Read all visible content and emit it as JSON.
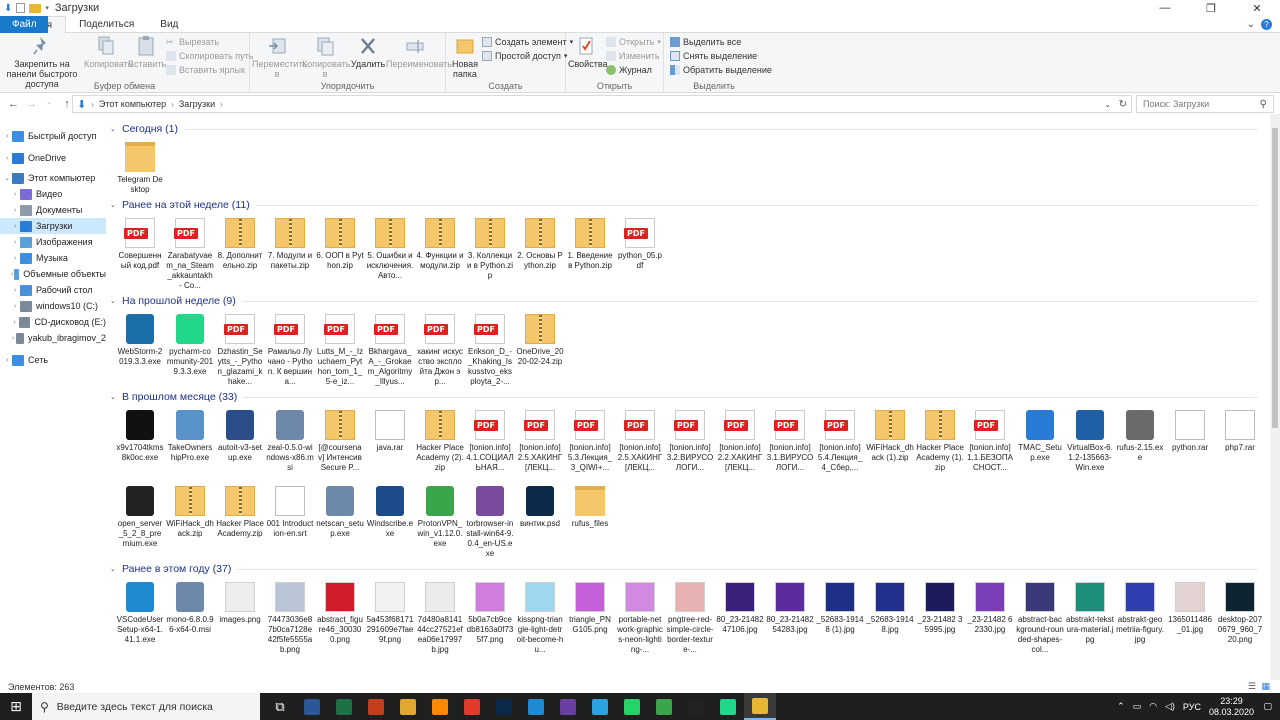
{
  "window": {
    "title": "Загрузки",
    "controls": [
      "—",
      "❐",
      "✕"
    ]
  },
  "tabs": [
    "Файл",
    "Главная",
    "Поделиться",
    "Вид"
  ],
  "ribbon": {
    "clipboard": {
      "pin": "Закрепить на панели быстрого доступа",
      "copy": "Копировать",
      "paste": "Вставить",
      "cut": "Вырезать",
      "copy_path": "Скопировать путь",
      "paste_shortcut": "Вставить ярлык",
      "label": "Буфер обмена"
    },
    "organize": {
      "move": "Переместить в",
      "copy_to": "Копировать в",
      "delete": "Удалить",
      "rename": "Переименовать",
      "label": "Упорядочить"
    },
    "create": {
      "new_folder": "Новая папка",
      "new_item": "Создать элемент",
      "easy_access": "Простой доступ",
      "label": "Создать"
    },
    "open": {
      "properties": "Свойства",
      "open": "Открыть",
      "edit": "Изменить",
      "history": "Журнал",
      "label": "Открыть"
    },
    "select": {
      "select_all": "Выделить все",
      "select_none": "Снять выделение",
      "invert": "Обратить выделение",
      "label": "Выделить"
    }
  },
  "address": {
    "path": [
      "Этот компьютер",
      "Загрузки"
    ],
    "search_placeholder": "Поиск: Загрузки"
  },
  "nav_pane": [
    {
      "label": "Быстрый доступ",
      "color": "#3d8ee0"
    },
    {
      "label": "OneDrive",
      "color": "#2a7bd6"
    },
    {
      "label": "Этот компьютер",
      "color": "#3b7bbf"
    },
    {
      "label": "Видео",
      "color": "#7c6ad6"
    },
    {
      "label": "Документы",
      "color": "#8e9aab"
    },
    {
      "label": "Загрузки",
      "color": "#2a7bd6",
      "selected": true
    },
    {
      "label": "Изображения",
      "color": "#5aa0d6"
    },
    {
      "label": "Музыка",
      "color": "#3d8ee0"
    },
    {
      "label": "Объемные объекты",
      "color": "#5aa0d6"
    },
    {
      "label": "Рабочий стол",
      "color": "#4a90d9"
    },
    {
      "label": "windows10 (C:)",
      "color": "#7a8a99"
    },
    {
      "label": "CD-дисковод (E:)",
      "color": "#7a8a99"
    },
    {
      "label": "yakub_ibragimov_2",
      "color": "#7a8a99"
    },
    {
      "label": "Сеть",
      "color": "#3d8ee0"
    }
  ],
  "groups": [
    {
      "title": "Сегодня (1)",
      "files": [
        {
          "name": "Telegram Desktop",
          "type": "folder"
        }
      ]
    },
    {
      "title": "Ранее на этой неделе (11)",
      "files": [
        {
          "name": "Совершенный код.pdf",
          "type": "pdf"
        },
        {
          "name": "Zarabatyvaem_na_Steam_akkauntakh - Co...",
          "type": "pdf"
        },
        {
          "name": "8. Дополнительно.zip",
          "type": "zip"
        },
        {
          "name": "7. Модули и пакеты.zip",
          "type": "zip"
        },
        {
          "name": "6. ООП в Python.zip",
          "type": "zip"
        },
        {
          "name": "5. Ошибки и исключения. Авто...",
          "type": "zip"
        },
        {
          "name": "4. Функции и модули.zip",
          "type": "zip"
        },
        {
          "name": "3. Коллекции в Python.zip",
          "type": "zip"
        },
        {
          "name": "2. Основы Python.zip",
          "type": "zip"
        },
        {
          "name": "1. Введение в Python.zip",
          "type": "zip"
        },
        {
          "name": "python_05.pdf",
          "type": "pdf"
        }
      ]
    },
    {
      "title": "На прошлой неделе (9)",
      "files": [
        {
          "name": "WebStorm-2019.3.3.exe",
          "type": "exe",
          "color": "#1b6ea8"
        },
        {
          "name": "pycharm-community-2019.3.3.exe",
          "type": "exe",
          "color": "#21d789"
        },
        {
          "name": "Dzhastin_Seytts_-_Python_glazami_khake...",
          "type": "pdf"
        },
        {
          "name": "Рамальо Лучано - Python. К вершина...",
          "type": "pdf"
        },
        {
          "name": "Lutts_M_-_Izuchaem_Python_tom_1_5-e_iz...",
          "type": "pdf"
        },
        {
          "name": "Bkhargava_A_-_Grokaem_Algoritmy_Illyus...",
          "type": "pdf"
        },
        {
          "name": "хакинг искусство эксплойта Джон эр...",
          "type": "pdf"
        },
        {
          "name": "Erikson_D_-_Khaking_Iskusstvo_eksployta_2-...",
          "type": "pdf"
        },
        {
          "name": "OneDrive_2020-02-24.zip",
          "type": "zip"
        }
      ]
    },
    {
      "title": "В прошлом месяце (33)",
      "files": [
        {
          "name": "x9v1704tkms8k0oc.exe",
          "type": "exe",
          "color": "#111"
        },
        {
          "name": "TakeOwnershipPro.exe",
          "type": "exe",
          "color": "#5a93c9"
        },
        {
          "name": "autoit-v3-setup.exe",
          "type": "exe",
          "color": "#2b4d8a"
        },
        {
          "name": "zeal-0.5.0-windows-x86.msi",
          "type": "exe",
          "color": "#6d88a8"
        },
        {
          "name": "[@coursenav] Интенсив Secure P...",
          "type": "zip"
        },
        {
          "name": "java.rar",
          "type": "blank"
        },
        {
          "name": "Hacker Place Academy (2).zip",
          "type": "zip"
        },
        {
          "name": "[tonion.info] 4.1.СОЦИАЛЬНАЯ...",
          "type": "pdf"
        },
        {
          "name": "[tonion.info] 2.5.ХАКИНГ [ЛЕКЦ...",
          "type": "pdf"
        },
        {
          "name": "[tonion.info] 5.3.Лекция_3_QIWI+...",
          "type": "pdf"
        },
        {
          "name": "[tonion.info] 2.5.ХАКИНГ [ЛЕКЦ...",
          "type": "pdf"
        },
        {
          "name": "[tonion.info] 3.2.ВИРУСОЛОГИ...",
          "type": "pdf"
        },
        {
          "name": "[tonion.info] 2.2.ХАКИНГ [ЛЕКЦ...",
          "type": "pdf"
        },
        {
          "name": "[tonion.info] 3.1.ВИРУСОЛОГИ...",
          "type": "pdf"
        },
        {
          "name": "[tonion.info] 5.4.Лекция_4_Сбер,...",
          "type": "pdf"
        },
        {
          "name": "WiFiHack_dhack (1).zip",
          "type": "zip"
        },
        {
          "name": "Hacker Place Academy (1).zip",
          "type": "zip"
        },
        {
          "name": "[tonion.info] 1.1.БЕЗОПАСНОСТ...",
          "type": "pdf"
        },
        {
          "name": "TMAC_Setup.exe",
          "type": "exe",
          "color": "#2a7bd6"
        },
        {
          "name": "VirtualBox-6.1.2-135663-Win.exe",
          "type": "exe",
          "color": "#1f5fa6"
        },
        {
          "name": "rufus-2.15.exe",
          "type": "exe",
          "color": "#6b6b6b"
        },
        {
          "name": "python.rar",
          "type": "blank"
        },
        {
          "name": "php7.rar",
          "type": "blank"
        },
        {
          "name": "open_server_5_2_8_premium.exe",
          "type": "exe",
          "color": "#222"
        },
        {
          "name": "WiFiHack_dhack.zip",
          "type": "zip"
        },
        {
          "name": "Hacker Place Academy.zip",
          "type": "zip"
        },
        {
          "name": "001 Introduction-en.srt",
          "type": "blank"
        },
        {
          "name": "netscan_setup.exe",
          "type": "exe",
          "color": "#6d88a8"
        },
        {
          "name": "Windscribe.exe",
          "type": "exe",
          "color": "#1c4a8a"
        },
        {
          "name": "ProtonVPN_win_v1.12.0.exe",
          "type": "exe",
          "color": "#3aa54b"
        },
        {
          "name": "torbrowser-install-win64-9.0.4_en-US.exe",
          "type": "exe",
          "color": "#7a4a9c"
        },
        {
          "name": "винтик.psd",
          "type": "exe",
          "color": "#0b2a4a"
        },
        {
          "name": "rufus_files",
          "type": "folder"
        }
      ]
    },
    {
      "title": "Ранее в этом году (37)",
      "files": [
        {
          "name": "VSCodeUserSetup-x64-1.41.1.exe",
          "type": "exe",
          "color": "#1f8ad2"
        },
        {
          "name": "mono-6.8.0.96-x64-0.msi",
          "type": "exe",
          "color": "#6d88a8"
        },
        {
          "name": "images.png",
          "type": "img",
          "color": "#eeeeee"
        },
        {
          "name": "74473036e87b0ca7128e42f5fe5555ab.png",
          "type": "img",
          "color": "#b9c4d6"
        },
        {
          "name": "abstract_figure46_300300.png",
          "type": "img",
          "color": "#d11d2b"
        },
        {
          "name": "5a453f68171291609e7fae9f.png",
          "type": "img",
          "color": "#f2f2f2"
        },
        {
          "name": "7d480a814144cc27521efea06e17997b.jpg",
          "type": "img",
          "color": "#ececec"
        },
        {
          "name": "5b0a7cb9cedb8163a0f735f7.png",
          "type": "img",
          "color": "#d07de0"
        },
        {
          "name": "kisspng-triangle-light-detroit-become-hu...",
          "type": "img",
          "color": "#9fd8ee"
        },
        {
          "name": "triangle_PNG105.png",
          "type": "img",
          "color": "#c55fd8"
        },
        {
          "name": "portable-network-graphics-neon-lighting-...",
          "type": "img",
          "color": "#d08ae0"
        },
        {
          "name": "pngtree-red-simple-circle-border-texture-...",
          "type": "img",
          "color": "#e7b2b2"
        },
        {
          "name": "80_23-2148247106.jpg",
          "type": "img",
          "color": "#3b1f7a"
        },
        {
          "name": "80_23-2148254283.jpg",
          "type": "img",
          "color": "#5b2c9e"
        },
        {
          "name": "_52683-19148 (1).jpg",
          "type": "img",
          "color": "#1f2f86"
        },
        {
          "name": "_52683-19148.jpg",
          "type": "img",
          "color": "#22308c"
        },
        {
          "name": "_23-21482 35995.jpg",
          "type": "img",
          "color": "#1c1c5c"
        },
        {
          "name": "_23-21482 62330.jpg",
          "type": "img",
          "color": "#7a3fb6"
        },
        {
          "name": "abstract-background-rounded-shapes-col...",
          "type": "img",
          "color": "#3a3a7a"
        },
        {
          "name": "abstrakt-tekstura-material.jpg",
          "type": "img",
          "color": "#1c8f7a"
        },
        {
          "name": "abstrakt-geometriia-figury.jpg",
          "type": "img",
          "color": "#2f3fb0"
        },
        {
          "name": "1365011486_01.jpg",
          "type": "img",
          "color": "#e3d2d2"
        },
        {
          "name": "desktop-2070679_960_720.png",
          "type": "img",
          "color": "#0e2432"
        }
      ]
    }
  ],
  "status": {
    "count": "Элементов: 263"
  },
  "taskbar": {
    "search_placeholder": "Введите здесь текст для поиска",
    "apps": [
      {
        "name": "task-view",
        "color": "#1f1f1f",
        "glyph": "⧉"
      },
      {
        "name": "word",
        "color": "#2b5797"
      },
      {
        "name": "excel",
        "color": "#1e7145"
      },
      {
        "name": "powerpoint",
        "color": "#c43e1c"
      },
      {
        "name": "chrome",
        "color": "#e0a82e"
      },
      {
        "name": "sublime",
        "color": "#ff8800"
      },
      {
        "name": "yandex-browser",
        "color": "#e23b2e"
      },
      {
        "name": "photoshop",
        "color": "#0b2a4a"
      },
      {
        "name": "vscode",
        "color": "#1f8ad2"
      },
      {
        "name": "vpn-shield",
        "color": "#6b3fa0"
      },
      {
        "name": "telegram",
        "color": "#2aa3df"
      },
      {
        "name": "whatsapp",
        "color": "#25d366"
      },
      {
        "name": "protonvpn",
        "color": "#3aa54b"
      },
      {
        "name": "game",
        "color": "#222"
      },
      {
        "name": "pycharm",
        "color": "#21d789"
      },
      {
        "name": "file-explorer",
        "color": "#e8b631",
        "active": true
      }
    ],
    "lang": "РУС",
    "time": "23:29",
    "date": "08.03.2020"
  }
}
